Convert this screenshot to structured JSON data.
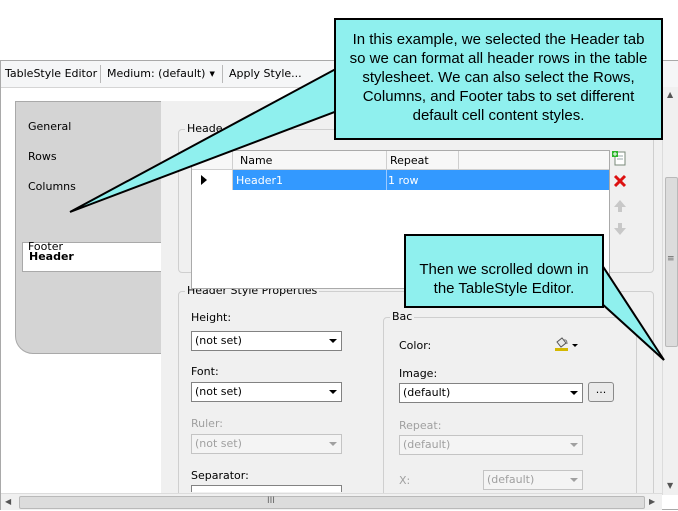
{
  "toolbar": {
    "title": "TableStyle Editor",
    "medium_label": "Medium: (default)",
    "apply_style_label": "Apply Style..."
  },
  "tabs": [
    {
      "label": "General"
    },
    {
      "label": "Rows"
    },
    {
      "label": "Columns"
    },
    {
      "label": "Header"
    },
    {
      "label": "Footer"
    }
  ],
  "selected_tab": "Header",
  "headers_group": {
    "title": "Heade",
    "columns": [
      "Name",
      "Repeat"
    ],
    "rows": [
      {
        "name": "Header1",
        "repeat": "1 row",
        "selected": true
      }
    ]
  },
  "icons": {
    "add": "add-row-icon",
    "delete": "delete-icon",
    "up": "move-up-icon",
    "down": "move-down-icon",
    "color_picker": "paint-bucket-icon"
  },
  "properties": {
    "title": "Header Style Properties",
    "height_label": "Height:",
    "height_value": "(not set)",
    "font_label": "Font:",
    "font_value": "(not set)",
    "ruler_label": "Ruler:",
    "ruler_value": "(not set)",
    "separator_label": "Separator:",
    "background_title": "Bac",
    "color_label": "Color:",
    "image_label": "Image:",
    "image_value": "(default)",
    "browse_label": "...",
    "repeat_label": "Repeat:",
    "repeat_value": "(default)",
    "x_label": "X:",
    "x_value": "(default)"
  },
  "scroll": {
    "h_grip": "III",
    "v_grip": "≡"
  },
  "callouts": {
    "top": "In this example, we selected the Header tab so we can format all header rows in the table stylesheet. We can also select the Rows, Columns, and Footer tabs to set different default cell content styles.",
    "right": "Then we scrolled down in the TableStyle Editor."
  },
  "colors": {
    "callout_bg": "#8ff0ee",
    "selection": "#3399ff",
    "delete_red": "#d11"
  }
}
